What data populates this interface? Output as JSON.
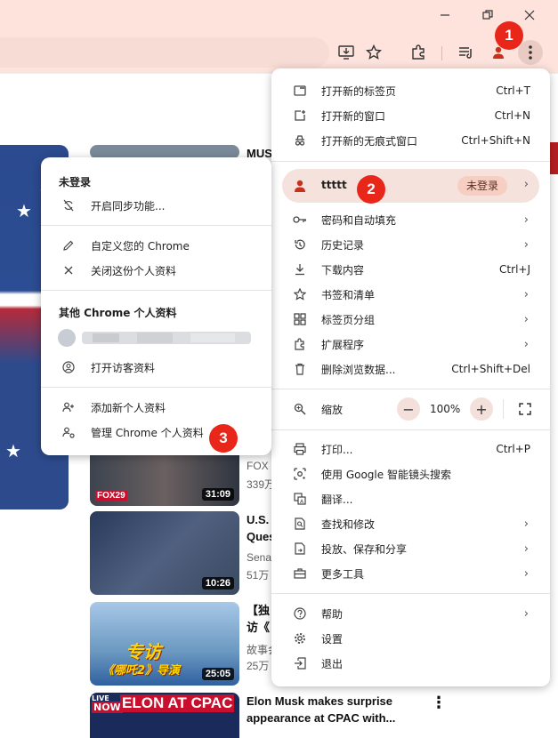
{
  "window_controls": {
    "minimize": "minimize",
    "restore": "restore",
    "close": "close"
  },
  "toolbar_icons": [
    "install-app-icon",
    "bookmark-star-icon",
    "extensions-icon",
    "reading-list-icon",
    "profile-icon",
    "more-menu-icon"
  ],
  "badges": {
    "one": "1",
    "two": "2",
    "three": "3"
  },
  "videos": [
    {
      "title": "MUS",
      "meta": "",
      "duration": ""
    },
    {
      "title": "",
      "meta": "",
      "duration": ""
    },
    {
      "title": "FOX 2",
      "meta": "339万",
      "duration": "31:09"
    },
    {
      "title": "U.S.",
      "title2": "Ques",
      "meta": "Senat",
      "meta2": "51万",
      "duration": "10:26"
    },
    {
      "title": "【独",
      "title2": "访《",
      "meta": "故事会",
      "meta2": "25万",
      "duration": "25:05"
    },
    {
      "title": "Elon Musk makes surprise",
      "title2": "appearance at CPAC with...",
      "duration": ""
    }
  ],
  "thumb_text": {
    "fox": "FOX29",
    "special_top": "专访",
    "special_bottom": "《哪吒2》导演",
    "elon_banner": "ELON AT CPAC",
    "live": "LIVE",
    "now": "NOW"
  },
  "chrome_menu": {
    "new_tab": {
      "label": "打开新的标签页",
      "shortcut": "Ctrl+T"
    },
    "new_window": {
      "label": "打开新的窗口",
      "shortcut": "Ctrl+N"
    },
    "incognito": {
      "label": "打开新的无痕式窗口",
      "shortcut": "Ctrl+Shift+N"
    },
    "profile": {
      "name": "ttttt",
      "status": "未登录"
    },
    "passwords": {
      "label": "密码和自动填充"
    },
    "history": {
      "label": "历史记录"
    },
    "downloads": {
      "label": "下载内容",
      "shortcut": "Ctrl+J"
    },
    "bookmarks": {
      "label": "书签和清单"
    },
    "tab_groups": {
      "label": "标签页分组"
    },
    "extensions": {
      "label": "扩展程序"
    },
    "clear_data": {
      "label": "删除浏览数据...",
      "shortcut": "Ctrl+Shift+Del"
    },
    "zoom": {
      "label": "缩放",
      "minus": "−",
      "value": "100%",
      "plus": "+"
    },
    "print": {
      "label": "打印...",
      "shortcut": "Ctrl+P"
    },
    "lens": {
      "label": "使用 Google 智能镜头搜索"
    },
    "translate": {
      "label": "翻译..."
    },
    "find": {
      "label": "查找和修改"
    },
    "cast": {
      "label": "投放、保存和分享"
    },
    "more_tools": {
      "label": "更多工具"
    },
    "help": {
      "label": "帮助"
    },
    "settings": {
      "label": "设置"
    },
    "exit": {
      "label": "退出"
    }
  },
  "profile_menu": {
    "not_signed_in": "未登录",
    "enable_sync": "开启同步功能...",
    "customize": "自定义您的 Chrome",
    "close_profile": "关闭这份个人资料",
    "other_profiles": "其他 Chrome 个人资料",
    "guest": "打开访客资料",
    "add_profile": "添加新个人资料",
    "manage_profiles": "管理 Chrome 个人资料"
  },
  "colors": {
    "accent": "#e8261a",
    "frame": "#fde3dc",
    "profile_highlight": "#f5e2dd",
    "not_signed_badge": "#f7cfc2"
  }
}
